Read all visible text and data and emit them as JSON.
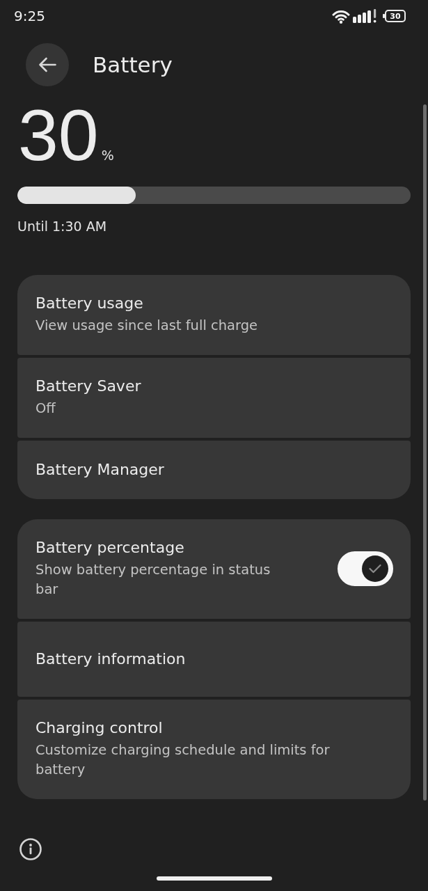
{
  "status_bar": {
    "time": "9:25",
    "battery_text": "30"
  },
  "header": {
    "title": "Battery"
  },
  "battery": {
    "percent": "30",
    "unit": "%",
    "level": 0.3,
    "estimate": "Until 1:30 AM"
  },
  "groups": [
    {
      "items": [
        {
          "kind": "link",
          "title": "Battery usage",
          "subtitle": "View usage since last full charge"
        },
        {
          "kind": "link",
          "title": "Battery Saver",
          "subtitle": "Off"
        },
        {
          "kind": "link",
          "title": "Battery Manager"
        }
      ]
    },
    {
      "items": [
        {
          "kind": "toggle",
          "title": "Battery percentage",
          "subtitle": "Show battery percentage in status bar",
          "on": true
        },
        {
          "kind": "link",
          "title": "Battery information"
        },
        {
          "kind": "link",
          "title": "Charging control",
          "subtitle": "Customize charging schedule and limits for battery"
        }
      ]
    }
  ]
}
